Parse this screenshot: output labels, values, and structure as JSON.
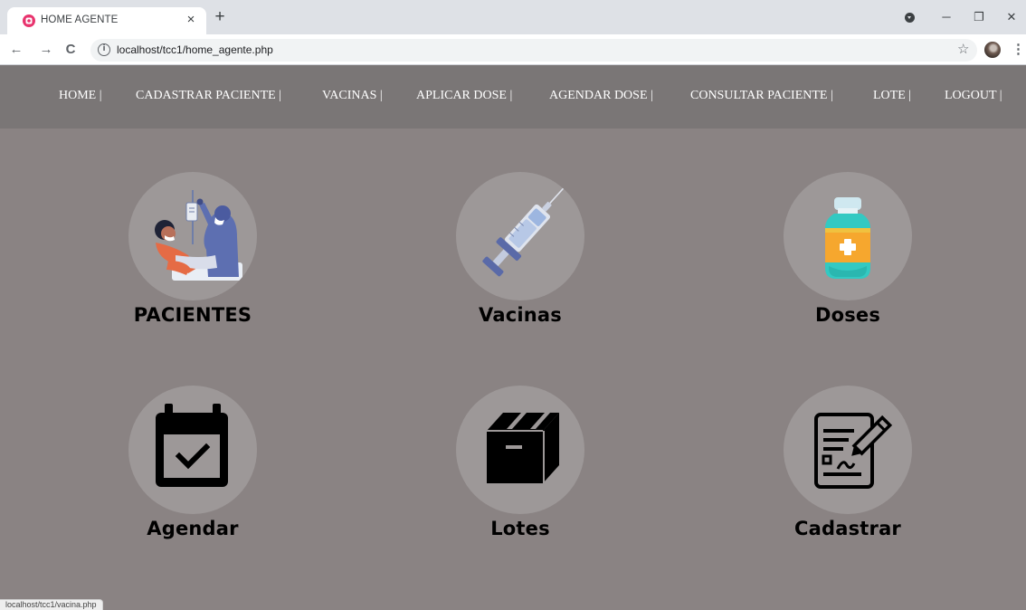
{
  "browser": {
    "tab_title": "HOME AGENTE",
    "tab_close": "×",
    "new_tab": "+",
    "url": "localhost/tcc1/home_agente.php",
    "status_url": "localhost/tcc1/vacina.php",
    "back": "←",
    "forward": "→",
    "reload": "C",
    "info": "i",
    "star": "☆",
    "menu": "⋮",
    "minimize": "─",
    "restore": "❐",
    "close": "✕"
  },
  "nav": {
    "items": [
      {
        "label": "HOME |"
      },
      {
        "label": "CADASTRAR PACIENTE |"
      },
      {
        "label": "VACINAS |"
      },
      {
        "label": "APLICAR DOSE |"
      },
      {
        "label": "AGENDAR DOSE |"
      },
      {
        "label": "CONSULTAR PACIENTE |"
      },
      {
        "label": "LOTE |"
      },
      {
        "label": "LOGOUT |"
      }
    ]
  },
  "cards": [
    {
      "label": "PACIENTES",
      "icon": "patient-care-icon"
    },
    {
      "label": "Vacinas",
      "icon": "syringe-icon"
    },
    {
      "label": "Doses",
      "icon": "vaccine-vial-icon"
    },
    {
      "label": "Agendar",
      "icon": "calendar-check-icon"
    },
    {
      "label": "Lotes",
      "icon": "box-icon"
    },
    {
      "label": "Cadastrar",
      "icon": "form-edit-icon"
    }
  ],
  "colors": {
    "page_bg": "#8a8383",
    "nav_bg": "#7a7676",
    "circle_bg": "#9d9898"
  }
}
